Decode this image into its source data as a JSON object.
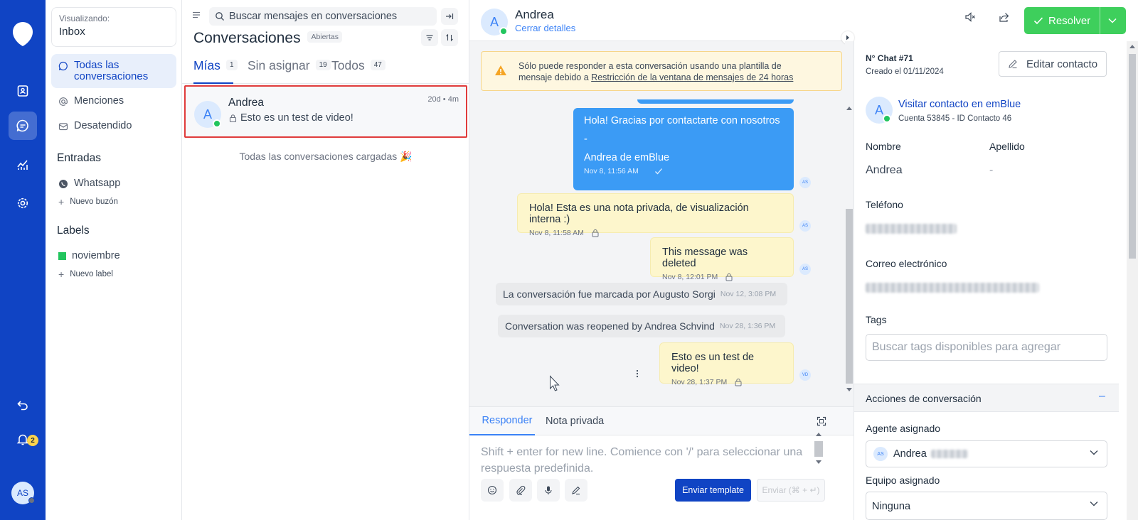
{
  "colors": {
    "rail": "#1044c4",
    "accent": "#1044c4",
    "link": "#3b82f6",
    "resolve": "#3ecf5c",
    "highlight": "#e03b3b",
    "label_noviembre": "#22c55e"
  },
  "rail": {
    "notification_count": "2",
    "user_initials": "AS",
    "icons": [
      "logo-icon",
      "contacts-icon",
      "conversations-icon",
      "reports-icon",
      "settings-icon",
      "back-icon",
      "bell-icon"
    ]
  },
  "sidebar": {
    "viewing_label": "Visualizando:",
    "viewing_value": "Inbox",
    "items": [
      {
        "label": "Todas las conversaciones",
        "icon": "chat-bubble-icon"
      },
      {
        "label": "Menciones",
        "icon": "at-icon"
      },
      {
        "label": "Desatendido",
        "icon": "unattended-icon"
      }
    ],
    "inboxes_heading": "Entradas",
    "inboxes": [
      {
        "label": "Whatsapp",
        "icon": "whatsapp-icon"
      }
    ],
    "new_inbox": "Nuevo buzón",
    "labels_heading": "Labels",
    "labels": [
      {
        "label": "noviembre"
      }
    ],
    "new_label": "Nuevo label"
  },
  "list": {
    "search_placeholder": "Buscar mensajes en conversaciones",
    "title": "Conversaciones",
    "status_pill": "Abiertas",
    "tabs": [
      {
        "label": "Mías",
        "count": "1"
      },
      {
        "label": "Sin asignar",
        "count": "19"
      },
      {
        "label": "Todos",
        "count": "47"
      }
    ],
    "conversations": [
      {
        "initial": "A",
        "name": "Andrea",
        "time": "20d • 4m",
        "preview": "Esto es un test de video!"
      }
    ],
    "footer": "Todas las conversaciones cargadas 🎉"
  },
  "chat": {
    "contact_initial": "A",
    "contact_name": "Andrea",
    "close_details": "Cerrar detalles",
    "resolve_label": "Resolver",
    "banner_text": "Sólo puede responder a esta conversación usando una plantilla de mensaje debido a",
    "banner_link": "Restricción de la ventana de mensajes de 24 horas",
    "messages": [
      {
        "kind": "out",
        "line1": "Hola! Gracias por contactarte con nosotros",
        "line2": "-",
        "line3": "Andrea de emBlue",
        "time": "Nov 8, 11:56 AM",
        "sender": "AS"
      },
      {
        "kind": "note",
        "text": "Hola! Esta es una nota privada, de visualización interna :)",
        "time": "Nov 8, 11:58 AM",
        "sender": "AS"
      },
      {
        "kind": "note",
        "text": "This message was deleted",
        "time": "Nov 8, 12:01 PM",
        "sender": "AS"
      },
      {
        "kind": "activity",
        "text": "La conversación fue marcada por Augusto Sorgi",
        "time": "Nov 12, 3:08 PM"
      },
      {
        "kind": "activity",
        "text": "Conversation was reopened by Andrea Schvind",
        "time": "Nov 28, 1:36 PM"
      },
      {
        "kind": "note",
        "text": "Esto es un test de video!",
        "time": "Nov 28, 1:37 PM",
        "sender": "VD"
      }
    ],
    "reply_tabs": [
      "Responder",
      "Nota privada"
    ],
    "reply_placeholder": "Shift + enter for new line. Comience con '/' para seleccionar una respuesta predefinida.",
    "send_template": "Enviar template",
    "send": "Enviar (⌘ + ↵)"
  },
  "contact": {
    "chat_number": "N° Chat #71",
    "created": "Creado el 01/11/2024",
    "edit_button": "Editar contacto",
    "initial": "A",
    "visit_link": "Visitar contacto en emBlue",
    "account_info": "Cuenta 53845 - ID Contacto 46",
    "first_name_label": "Nombre",
    "first_name": "Andrea",
    "last_name_label": "Apellido",
    "last_name": "-",
    "phone_label": "Teléfono",
    "email_label": "Correo electrónico",
    "tags_label": "Tags",
    "tags_placeholder": "Buscar tags disponibles para agregar",
    "actions_heading": "Acciones de conversación",
    "actions_toggle": "–",
    "agent_label": "Agente asignado",
    "agent_initials": "AS",
    "agent_name": "Andrea",
    "team_label": "Equipo asignado",
    "team_value": "Ninguna"
  }
}
